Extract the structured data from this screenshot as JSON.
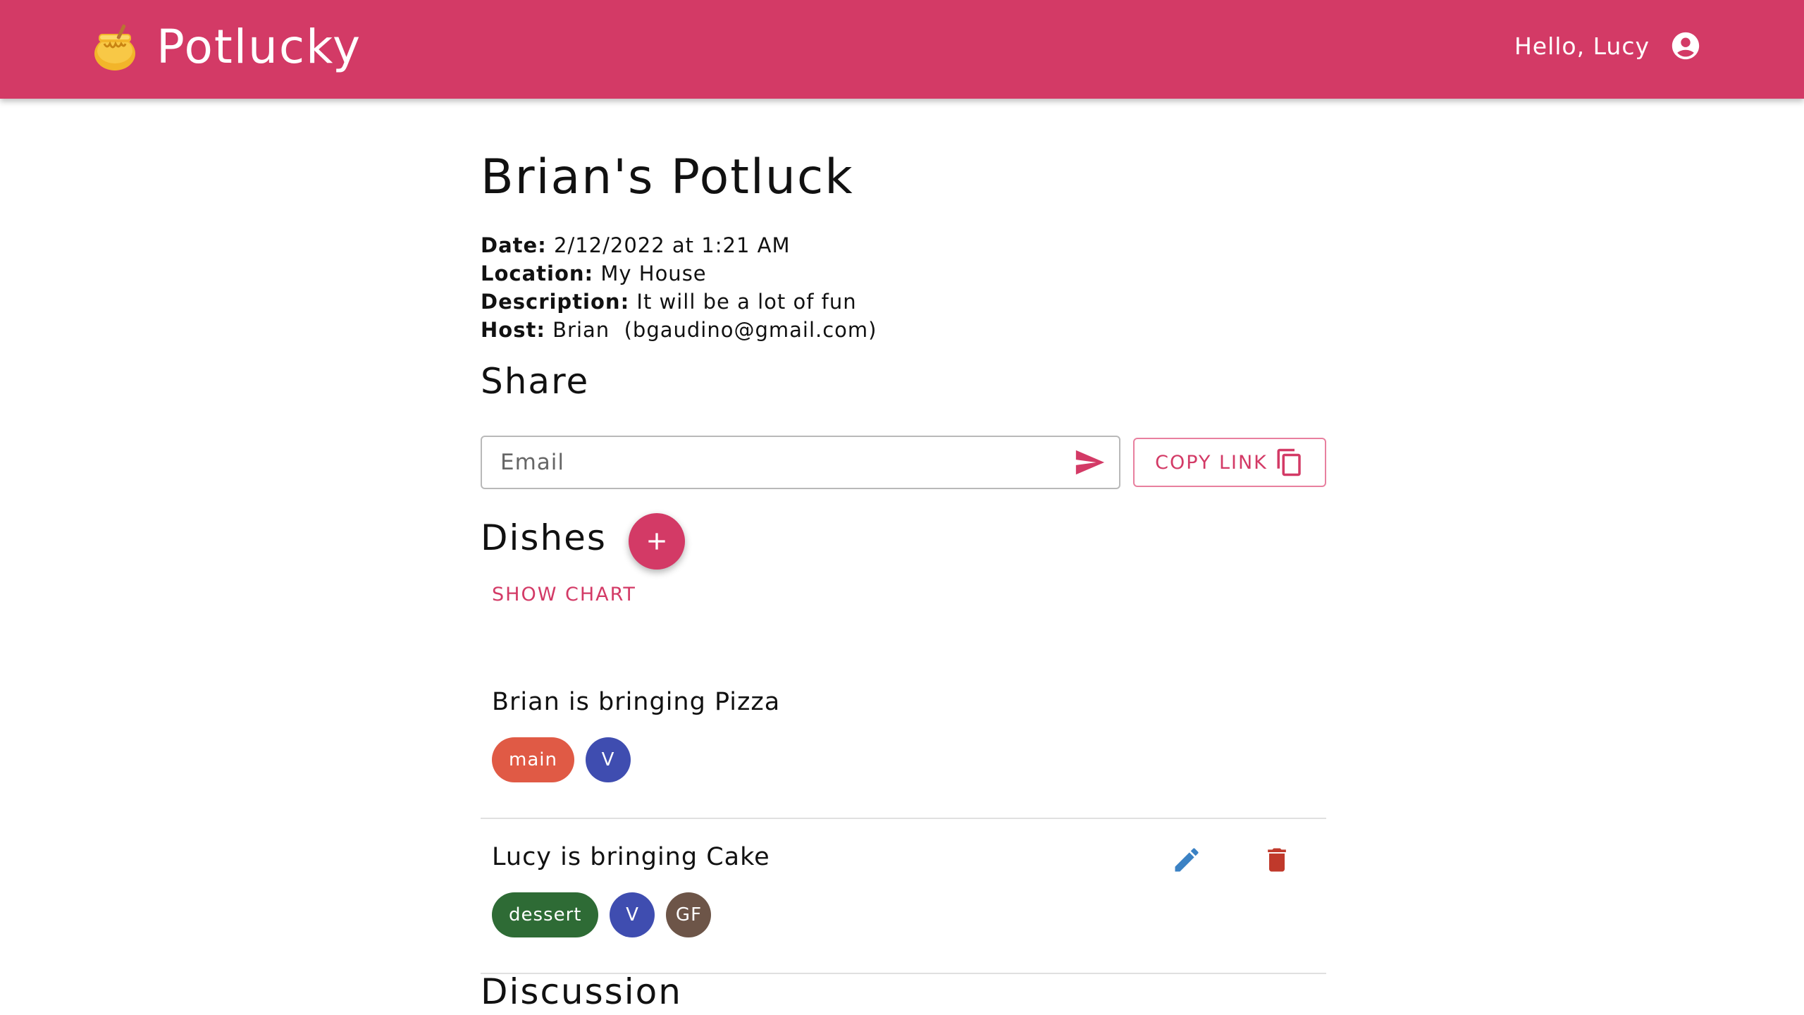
{
  "app": {
    "title": "Potlucky",
    "logo_icon": "honey-pot-icon",
    "accent_color": "#d33a66"
  },
  "user": {
    "greeting": "Hello, Lucy",
    "icon": "account-circle-icon"
  },
  "event": {
    "title": "Brian's Potluck",
    "details": [
      {
        "label": "Date:",
        "value": "2/12/2022 at 1:21 AM"
      },
      {
        "label": "Location:",
        "value": "My House"
      },
      {
        "label": "Description:",
        "value": "It will be a lot of fun"
      },
      {
        "label": "Host:",
        "value": "Brian  (bgaudino@gmail.com)"
      }
    ]
  },
  "share": {
    "heading": "Share",
    "email_placeholder": "Email",
    "email_value": "",
    "send_icon": "send-icon",
    "copy_link_label": "COPY LINK",
    "copy_icon": "copy-icon"
  },
  "dishes": {
    "heading": "Dishes",
    "add_icon": "plus-icon",
    "show_chart_label": "SHOW CHART",
    "items": [
      {
        "text": "Brian is bringing Pizza",
        "tags": [
          {
            "label": "main",
            "color": "#e05a45"
          },
          {
            "label": "V",
            "color": "#3f4db0"
          }
        ],
        "editable": false
      },
      {
        "text": "Lucy is bringing Cake",
        "tags": [
          {
            "label": "dessert",
            "color": "#2e6b35"
          },
          {
            "label": "V",
            "color": "#3f4db0"
          },
          {
            "label": "GF",
            "color": "#6d5548"
          }
        ],
        "editable": true,
        "edit_icon": "pencil-icon",
        "delete_icon": "trash-icon"
      }
    ]
  },
  "discussion": {
    "heading": "Discussion"
  }
}
